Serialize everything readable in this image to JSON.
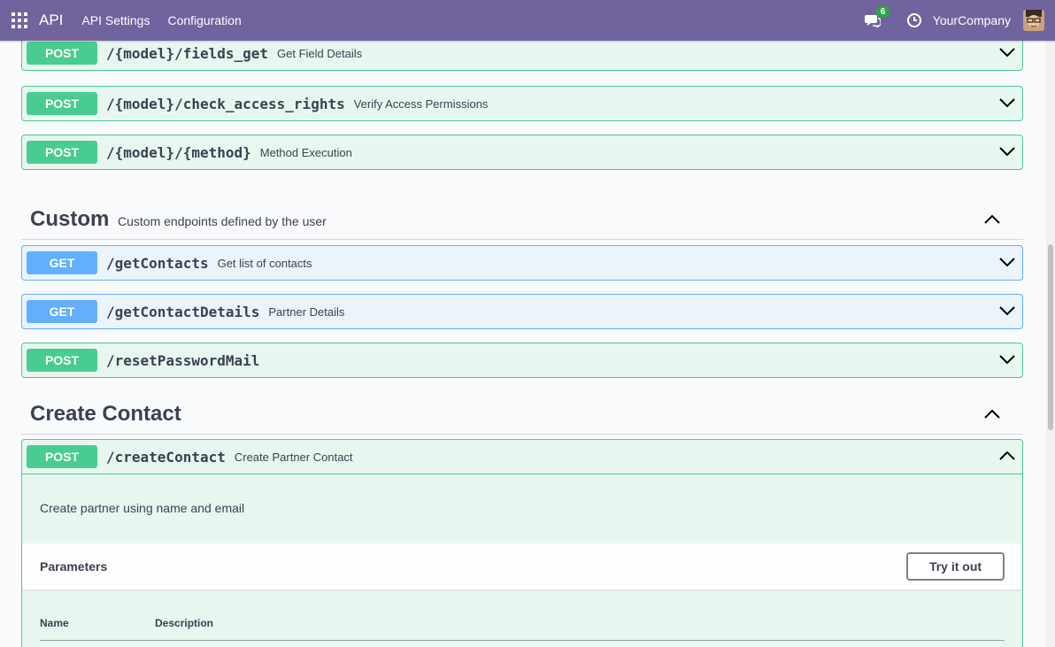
{
  "topbar": {
    "app_title": "API",
    "nav": [
      "API Settings",
      "Configuration"
    ],
    "messages_count": "6",
    "company": "YourCompany"
  },
  "ops_top": [
    {
      "method": "POST",
      "path": "/{model}/fields_get",
      "summary": "Get Field Details"
    },
    {
      "method": "POST",
      "path": "/{model}/check_access_rights",
      "summary": "Verify Access Permissions"
    },
    {
      "method": "POST",
      "path": "/{model}/{method}",
      "summary": "Method Execution"
    }
  ],
  "custom_section": {
    "title": "Custom",
    "description": "Custom endpoints defined by the user"
  },
  "custom_ops": [
    {
      "method": "GET",
      "path": "/getContacts",
      "summary": "Get list of contacts"
    },
    {
      "method": "GET",
      "path": "/getContactDetails",
      "summary": "Partner Details"
    },
    {
      "method": "POST",
      "path": "/resetPasswordMail",
      "summary": ""
    }
  ],
  "create_section": {
    "title": "Create Contact"
  },
  "create_op": {
    "method": "POST",
    "path": "/createContact",
    "summary": "Create Partner Contact",
    "description": "Create partner using name and email",
    "parameters_label": "Parameters",
    "try_label": "Try it out",
    "columns": [
      "Name",
      "Description"
    ]
  },
  "colors": {
    "topbar": "#71639e",
    "post": "#49cc90",
    "get": "#61affe"
  }
}
